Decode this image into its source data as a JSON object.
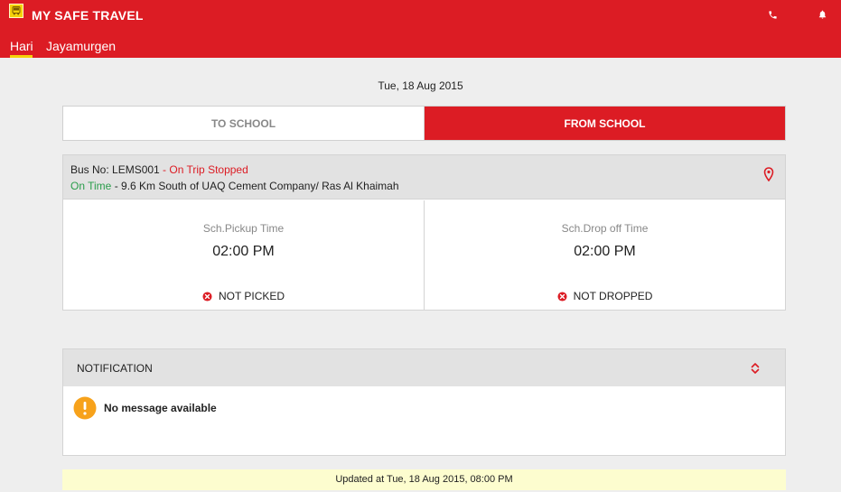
{
  "app": {
    "title": "MY SAFE TRAVEL",
    "accent_color": "#dc1c24",
    "logo_icon": "bus-logo-icon",
    "actions": [
      {
        "name": "call",
        "icon": "phone-icon"
      },
      {
        "name": "notifications",
        "icon": "bell-icon"
      }
    ]
  },
  "children": {
    "tabs": [
      {
        "label": "Hari",
        "active": true
      },
      {
        "label": "Jayamurgen",
        "active": false
      }
    ]
  },
  "date": "Tue, 18 Aug 2015",
  "trip_toggle": {
    "to_school": "TO SCHOOL",
    "from_school": "FROM SCHOOL",
    "selected": "FROM SCHOOL"
  },
  "bus": {
    "bus_label": "Bus No: LEMS001",
    "trip_status": " - On Trip Stopped",
    "timeliness": "On Time",
    "location": " - 9.6 Km South of UAQ Cement Company/ Ras Al Khaimah",
    "location_icon": "map-pin-icon",
    "status_colors": {
      "trip_status": "#dc1c24",
      "timeliness": "#2a9d4b"
    }
  },
  "schedule": {
    "pickup": {
      "label": "Sch.Pickup Time",
      "time": "02:00 PM",
      "status": "NOT PICKED",
      "status_icon": "cancel-circle-icon"
    },
    "dropoff": {
      "label": "Sch.Drop off Time",
      "time": "02:00 PM",
      "status": "NOT DROPPED",
      "status_icon": "cancel-circle-icon"
    }
  },
  "notification": {
    "title": "NOTIFICATION",
    "toggle_icon": "expand-collapse-icon",
    "message": "No message available",
    "message_icon": "warning-circle-icon"
  },
  "footer": {
    "updated_text": "Updated at Tue, 18 Aug 2015, 08:00 PM"
  }
}
